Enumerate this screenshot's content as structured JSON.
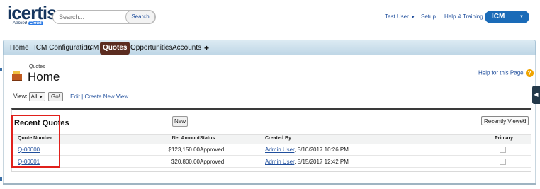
{
  "header": {
    "logo_text": "icertis",
    "logo_sub": "Applied",
    "logo_cloud": "Cloud",
    "search_placeholder": "Search...",
    "search_button": "Search",
    "user_menu": "Test User",
    "setup_link": "Setup",
    "help_link": "Help & Training",
    "app_switcher": "ICM"
  },
  "tabs": [
    {
      "label": "Home"
    },
    {
      "label": "ICM Configuration"
    },
    {
      "label": "ICM"
    },
    {
      "label": "Quotes",
      "active": true
    },
    {
      "label": "Opportunities"
    },
    {
      "label": "Accounts"
    },
    {
      "label": "+"
    }
  ],
  "page": {
    "breadcrumb": "Quotes",
    "title": "Home",
    "help_link": "Help for this Page",
    "help_icon": "?",
    "view_label": "View:",
    "view_selected": "All",
    "go_button": "Go!",
    "edit_link": "Edit",
    "separator": "|",
    "create_view_link": "Create New View"
  },
  "recent": {
    "title": "Recent Quotes",
    "new_button": "New",
    "sort_select": "Recently Viewed",
    "columns": {
      "number": "Quote Number",
      "amount": "Net Amount",
      "status": "Status",
      "created": "Created By",
      "primary": "Primary"
    },
    "rows": [
      {
        "number": "Q-00000",
        "amount": "$123,150.00",
        "status": "Approved",
        "created_user": "Admin User",
        "created_date": ", 5/10/2017 10:26 PM",
        "primary": false
      },
      {
        "number": "Q-00001",
        "amount": "$20,800.00",
        "status": "Approved",
        "created_user": "Admin User",
        "created_date": ", 5/15/2017 12:42 PM",
        "primary": false
      }
    ]
  },
  "colors": {
    "active_tab": "#5b2c20",
    "app_button": "#1a6bb8",
    "link": "#1f4e9c",
    "highlight_box": "#e0201b"
  }
}
